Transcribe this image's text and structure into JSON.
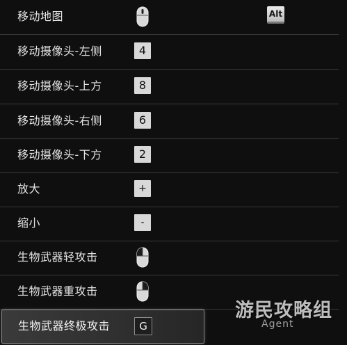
{
  "keybind_list": {
    "rows": [
      {
        "label": "移动地图",
        "binding": "mouse-middle",
        "extra_key": "Alt"
      },
      {
        "label": "移动摄像头-左侧",
        "binding": "key",
        "key": "4"
      },
      {
        "label": "移动摄像头-上方",
        "binding": "key",
        "key": "8"
      },
      {
        "label": "移动摄像头-右侧",
        "binding": "key",
        "key": "6"
      },
      {
        "label": "移动摄像头-下方",
        "binding": "key",
        "key": "2"
      },
      {
        "label": "放大",
        "binding": "key",
        "key": "+"
      },
      {
        "label": "缩小",
        "binding": "key",
        "key": "-"
      },
      {
        "label": "生物武器轻攻击",
        "binding": "mouse-left"
      },
      {
        "label": "生物武器重攻击",
        "binding": "mouse-right"
      },
      {
        "label": "生物武器终极攻击",
        "binding": "key",
        "key": "G",
        "selected": true
      }
    ]
  },
  "watermark": {
    "title": "游民攻略组",
    "subtitle": "Agent"
  },
  "colors": {
    "background": "#0f0f0f",
    "divider": "#3a3a3a",
    "keycap": "#d8d8d8",
    "selected_border": "#8a8a8a"
  }
}
